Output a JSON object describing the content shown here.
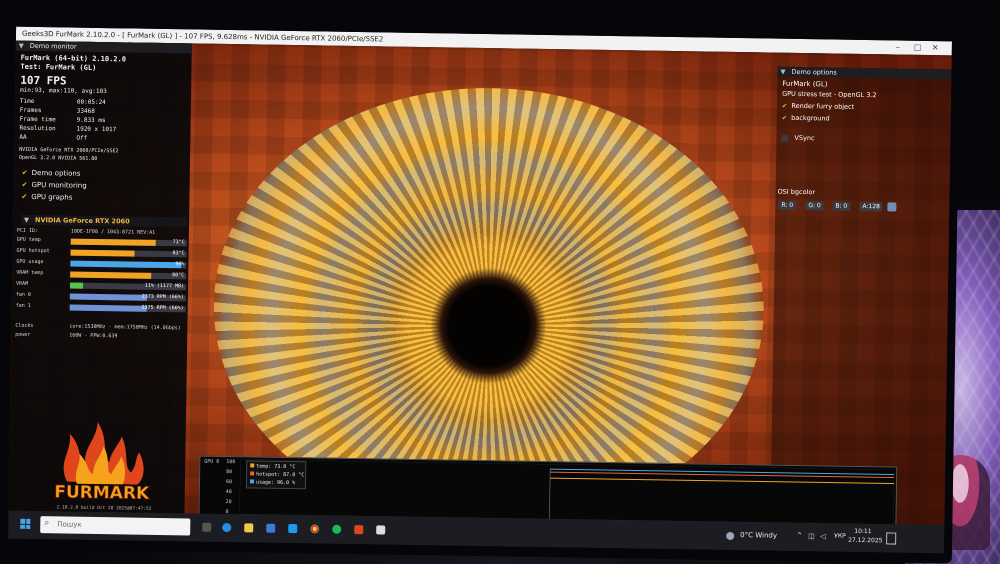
{
  "window": {
    "title": "Geeks3D FurMark 2.10.2.0 - [ FurMark (GL) ] - 107 FPS, 9.628ms - NVIDIA GeForce RTX 2060/PCIe/SSE2"
  },
  "demo_monitor": {
    "header": "Demo monitor",
    "app_line": "FurMark (64-bit) 2.10.2.0",
    "test_line": "Test: FurMark (GL)",
    "fps": "107 FPS",
    "fps_stats": "min:93, max:110, avg:103",
    "stats": [
      {
        "label": "Time",
        "value": "00:05:24"
      },
      {
        "label": "Frames",
        "value": "33468"
      },
      {
        "label": "Frame time",
        "value": "9.833 ms"
      },
      {
        "label": "Resolution",
        "value": "1920 x 1017"
      },
      {
        "label": "AA",
        "value": "Off"
      }
    ],
    "gpu_line1": "NVIDIA GeForce RTX 2060/PCIe/SSE2",
    "gpu_line2": "OpenGL 3.2.0 NVIDIA 561.80",
    "options": [
      {
        "label": "Demo options",
        "checked": true
      },
      {
        "label": "GPU monitoring",
        "checked": true
      },
      {
        "label": "GPU graphs",
        "checked": true
      }
    ]
  },
  "gpu_panel": {
    "header": "NVIDIA GeForce RTX 2060",
    "pci_label": "PCI ID:",
    "pci_value": "10DE-1F08 / 1043-8721 REV:A1",
    "metrics": [
      {
        "label": "GPU temp",
        "text": "73°C",
        "fraction": 0.73,
        "color": "#f1a324"
      },
      {
        "label": "GPU hotspot",
        "text": "83°C",
        "fraction": 0.55,
        "color": "#f1a324"
      },
      {
        "label": "GPU usage",
        "text": "96%",
        "fraction": 0.96,
        "color": "#4aa6e8"
      },
      {
        "label": "VRAM temp",
        "text": "80°C",
        "fraction": 0.7,
        "color": "#f1a324"
      },
      {
        "label": "VRAM",
        "text": "11% (1177 MB)",
        "fraction": 0.11,
        "color": "#58c24e"
      },
      {
        "label": "fan 0",
        "text": "2373 RPM (66%)",
        "fraction": 0.66,
        "color": "#6f93d6"
      },
      {
        "label": "fan 1",
        "text": "2375 RPM (66%)",
        "fraction": 0.66,
        "color": "#6f93d6"
      }
    ],
    "clocks_label": "Clocks",
    "clocks_value": "core:1530MHz - mem:1750MHz (14.0Gbps)",
    "power_label": "power",
    "power_value": "160W - PPW:0.639"
  },
  "logo": {
    "text": "FURMARK",
    "version": "2.10.2.0 build Oct 28 2025@07:47:52"
  },
  "demo_options": {
    "header": "Demo options",
    "title": "FurMark (GL)",
    "subtitle": "GPU stress test - OpenGL 3.2",
    "render_furry": "Render furry object",
    "background": "background",
    "vsync": "VSync",
    "osi_label": "OSI bgcolor",
    "r": "R: 0",
    "g": "G: 0",
    "b": "B: 0",
    "a": "A:128"
  },
  "gpu_graph": {
    "label": "GPU 0",
    "y_ticks": [
      "100",
      "80",
      "60",
      "40",
      "20",
      "0"
    ],
    "legend": [
      {
        "label": "temp: 73.0 °C",
        "color": "#f1a324"
      },
      {
        "label": "hotspot: 87.0 °C",
        "color": "#e26a2c"
      },
      {
        "label": "usage: 96.0 %",
        "color": "#4aa6e8"
      }
    ]
  },
  "taskbar": {
    "search_placeholder": "Пошук",
    "weather": "0°C Windy",
    "lang": "УКР",
    "time": "10:11",
    "date": "27.12.2025"
  }
}
